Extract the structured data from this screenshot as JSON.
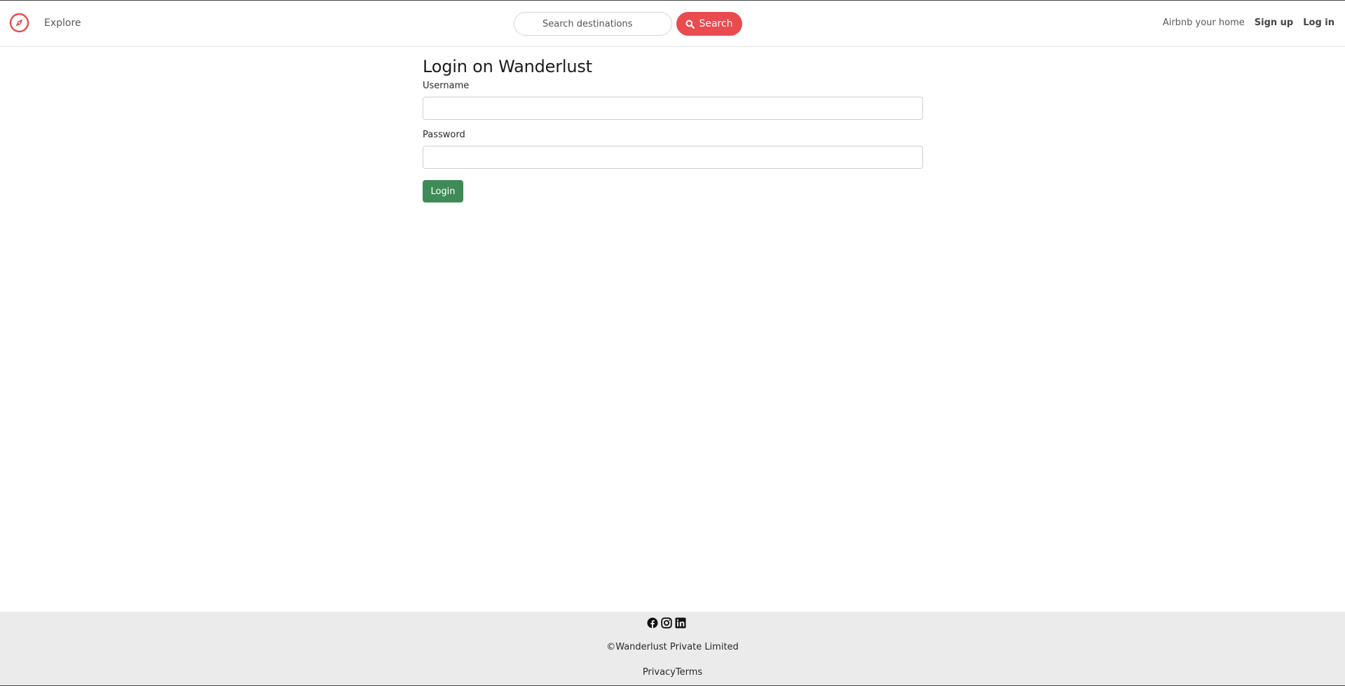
{
  "navbar": {
    "explore_label": "Explore",
    "search_placeholder": "Search destinations",
    "search_button_label": "Search",
    "airbnb_home_label": "Airbnb your home",
    "signup_label": "Sign up",
    "login_label": "Log in"
  },
  "main": {
    "title": "Login on Wanderlust",
    "username_label": "Username",
    "username_value": "",
    "password_label": "Password",
    "password_value": "",
    "login_button_label": "Login"
  },
  "footer": {
    "socials": [
      "facebook-icon",
      "instagram-icon",
      "linkedin-icon"
    ],
    "copyright": "©Wanderlust Private Limited",
    "privacy_label": "Privacy",
    "terms_label": "Terms"
  },
  "colors": {
    "brand": "#e94b4f",
    "login_button": "#3f8b58",
    "footer_bg": "#ebebeb"
  }
}
